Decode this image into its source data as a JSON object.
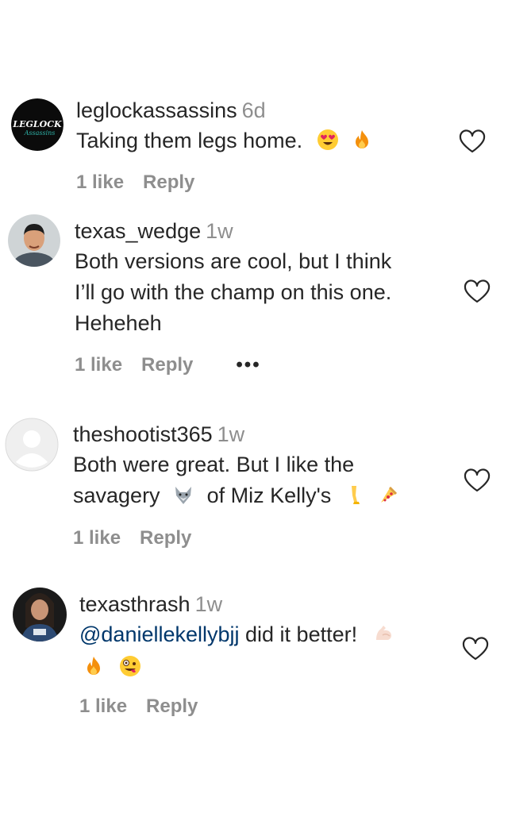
{
  "comments": [
    {
      "username": "leglockassassins",
      "time": "6d",
      "text": "Taking them legs home.",
      "emojis": [
        "heart-eyes-emoji",
        "fire-emoji"
      ],
      "likes": "1 like",
      "reply": "Reply",
      "avatar_text": "LEGLOCK"
    },
    {
      "username": "texas_wedge",
      "time": "1w",
      "lines": [
        "Both versions are cool, but I think",
        "I’ll go with the champ on this one.",
        "Heheheh"
      ],
      "likes": "1 like",
      "reply": "Reply",
      "more": "•••"
    },
    {
      "username": "theshootist365",
      "time": "1w",
      "line1": "Both were great. But I like the",
      "line2a": "savagery",
      "line2b": "of Miz Kelly's",
      "emojis": [
        "wolf-emoji",
        "leg-emoji",
        "pizza-emoji"
      ],
      "likes": "1 like",
      "reply": "Reply"
    },
    {
      "username": "texasthrash",
      "time": "1w",
      "mention": "@daniellekellybjj",
      "text": " did it better!",
      "emojis": [
        "flexed-biceps-emoji",
        "fire-emoji",
        "zany-face-emoji"
      ],
      "likes": "1 like",
      "reply": "Reply"
    }
  ]
}
